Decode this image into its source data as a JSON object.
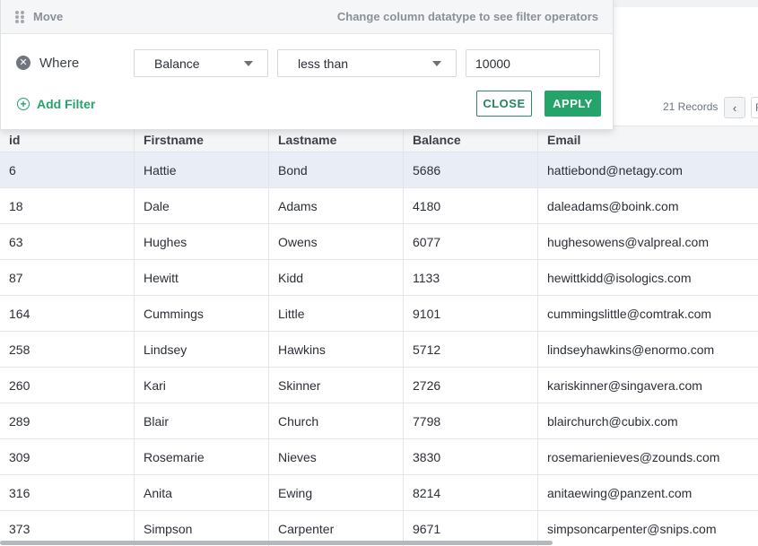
{
  "filter_panel": {
    "move_label": "Move",
    "hint": "Change column datatype to see filter operators",
    "where_label": "Where",
    "column_select": "Balance",
    "operator_select": "less than",
    "value": "10000",
    "add_filter_label": "Add Filter",
    "close_label": "CLOSE",
    "apply_label": "APPLY"
  },
  "toolbar": {
    "records": "21 Records",
    "pager_next_partial": "F"
  },
  "table": {
    "columns": [
      "id",
      "Firstname",
      "Lastname",
      "Balance",
      "Email"
    ],
    "rows": [
      [
        "6",
        "Hattie",
        "Bond",
        "5686",
        "hattiebond@netagy.com"
      ],
      [
        "18",
        "Dale",
        "Adams",
        "4180",
        "daleadams@boink.com"
      ],
      [
        "63",
        "Hughes",
        "Owens",
        "6077",
        "hughesowens@valpreal.com"
      ],
      [
        "87",
        "Hewitt",
        "Kidd",
        "1133",
        "hewittkidd@isologics.com"
      ],
      [
        "164",
        "Cummings",
        "Little",
        "9101",
        "cummingslittle@comtrak.com"
      ],
      [
        "258",
        "Lindsey",
        "Hawkins",
        "5712",
        "lindseyhawkins@enormo.com"
      ],
      [
        "260",
        "Kari",
        "Skinner",
        "2726",
        "kariskinner@singavera.com"
      ],
      [
        "289",
        "Blair",
        "Church",
        "7798",
        "blairchurch@cubix.com"
      ],
      [
        "309",
        "Rosemarie",
        "Nieves",
        "3830",
        "rosemarienieves@zounds.com"
      ],
      [
        "316",
        "Anita",
        "Ewing",
        "8214",
        "anitaewing@panzent.com"
      ],
      [
        "373",
        "Simpson",
        "Carpenter",
        "9671",
        "simpsoncarpenter@snips.com"
      ]
    ]
  },
  "colors": {
    "accent": "#24a36a",
    "selected_row": "#e9edf5"
  }
}
